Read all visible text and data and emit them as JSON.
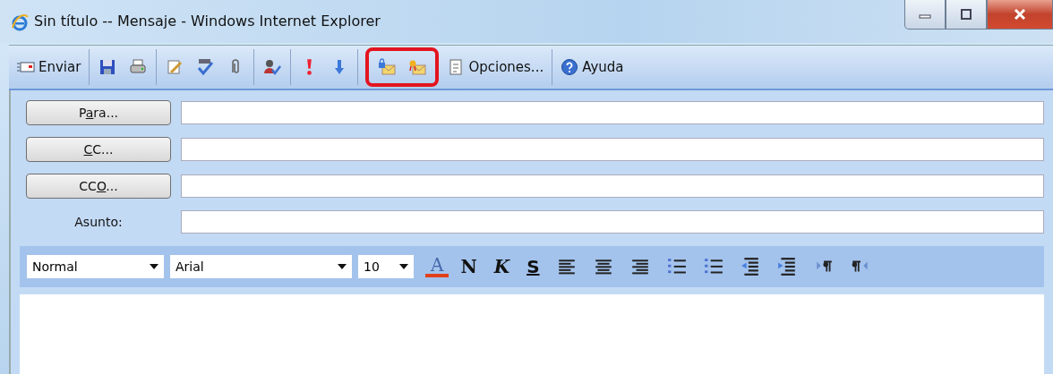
{
  "window": {
    "title": "Sin título -- Mensaje - Windows Internet Explorer"
  },
  "toolbar": {
    "groups": [
      {
        "highlighted": false,
        "items": [
          {
            "kind": "send",
            "label": "Enviar"
          }
        ]
      },
      {
        "highlighted": false,
        "items": [
          {
            "kind": "save"
          },
          {
            "kind": "print"
          }
        ]
      },
      {
        "highlighted": false,
        "items": [
          {
            "kind": "edit"
          },
          {
            "kind": "spell"
          },
          {
            "kind": "attach"
          }
        ]
      },
      {
        "highlighted": false,
        "items": [
          {
            "kind": "check-names"
          }
        ]
      },
      {
        "highlighted": false,
        "items": [
          {
            "kind": "high-priority"
          },
          {
            "kind": "low-priority"
          }
        ]
      },
      {
        "highlighted": true,
        "items": [
          {
            "kind": "encrypt"
          },
          {
            "kind": "sign"
          }
        ]
      },
      {
        "highlighted": false,
        "items": [
          {
            "kind": "options",
            "label": "Opciones..."
          }
        ]
      },
      {
        "highlighted": false,
        "items": [
          {
            "kind": "help",
            "label": "Ayuda"
          }
        ]
      }
    ]
  },
  "header": {
    "rows": [
      {
        "kind": "button",
        "before": "P",
        "key": "a",
        "after": "ra..."
      },
      {
        "kind": "button",
        "before": "",
        "key": "C",
        "after": "C..."
      },
      {
        "kind": "button",
        "before": "CC",
        "key": "O",
        "after": "..."
      },
      {
        "kind": "label",
        "label": "Asunto:"
      }
    ]
  },
  "format_bar": {
    "style": "Normal",
    "font": "Arial",
    "size": "10",
    "buttons": [
      {
        "kind": "color",
        "label": "A"
      },
      {
        "kind": "bold",
        "label": "N"
      },
      {
        "kind": "italic",
        "label": "K"
      },
      {
        "kind": "underline",
        "label": "S"
      },
      {
        "kind": "align-left"
      },
      {
        "kind": "align-center"
      },
      {
        "kind": "align-right"
      },
      {
        "kind": "bullets"
      },
      {
        "kind": "numbering"
      },
      {
        "kind": "outdent"
      },
      {
        "kind": "indent"
      },
      {
        "kind": "ltr"
      },
      {
        "kind": "rtl"
      }
    ]
  }
}
